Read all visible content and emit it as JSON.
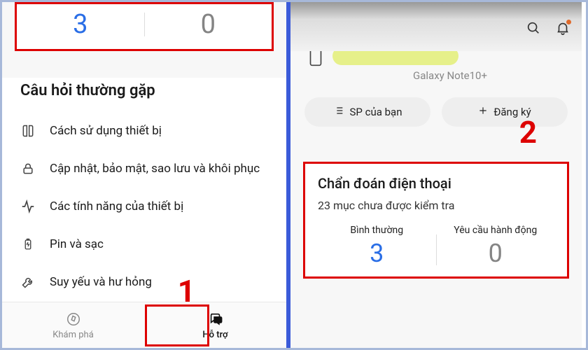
{
  "left": {
    "stats": {
      "normal": "3",
      "action": "0"
    },
    "faq_title": "Câu hỏi thường gặp",
    "faq": [
      {
        "icon": "book",
        "label": "Cách sử dụng thiết bị"
      },
      {
        "icon": "lock",
        "label": "Cập nhật, bảo mật, sao lưu và khôi phục"
      },
      {
        "icon": "activity",
        "label": "Các tính năng của thiết bị"
      },
      {
        "icon": "battery",
        "label": "Pin và sạc"
      },
      {
        "icon": "wrench",
        "label": "Suy yếu và hư hỏng"
      }
    ],
    "nav": {
      "explore": "Khám phá",
      "support": "Hỗ trợ"
    }
  },
  "right": {
    "device_model": "Galaxy Note10+",
    "pills": {
      "your_sp": "SP của bạn",
      "register": "Đăng ký"
    },
    "diag": {
      "title": "Chẩn đoán điện thoại",
      "sub": "23 mục chưa được kiểm tra",
      "normal_label": "Bình thường",
      "normal_value": "3",
      "action_label": "Yêu cầu hành động",
      "action_value": "0"
    }
  },
  "annotations": {
    "one": "1",
    "two": "2"
  }
}
